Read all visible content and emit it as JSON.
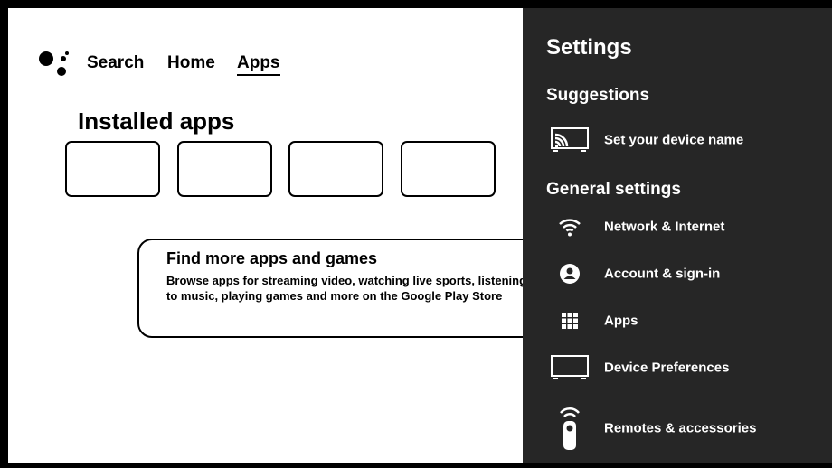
{
  "nav": {
    "search": "Search",
    "home": "Home",
    "apps": "Apps"
  },
  "main": {
    "installed_title": "Installed apps",
    "promo": {
      "title": "Find more apps and games",
      "text": "Browse apps for streaming video, watching live sports, listening to music, playing games and more on the Google Play Store"
    }
  },
  "settings": {
    "title": "Settings",
    "suggestions_heading": "Suggestions",
    "general_heading": "General settings",
    "items": [
      {
        "label": "Set your device name",
        "icon": "cast-tv-icon"
      },
      {
        "label": "Network & Internet",
        "icon": "wifi-icon"
      },
      {
        "label": "Account & sign-in",
        "icon": "account-icon"
      },
      {
        "label": "Apps",
        "icon": "apps-grid-icon"
      },
      {
        "label": "Device Preferences",
        "icon": "tv-icon"
      },
      {
        "label": "Remotes & accessories",
        "icon": "remote-icon"
      }
    ]
  },
  "colors": {
    "panel_background": "#262626",
    "screen_background": "#ffffff",
    "frame": "#000000"
  }
}
